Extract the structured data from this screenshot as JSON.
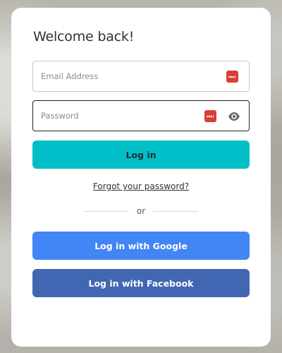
{
  "login": {
    "title": "Welcome back!",
    "email": {
      "placeholder": "Email Address",
      "value": ""
    },
    "password": {
      "placeholder": "Password",
      "value": ""
    },
    "login_button": "Log in",
    "forgot_link": "Forgot your password?",
    "divider_text": "or",
    "google_button": "Log in with Google",
    "facebook_button": "Log in with Facebook"
  },
  "icons": {
    "password_manager": "password-manager-icon",
    "show_password": "eye-icon"
  },
  "colors": {
    "login_button": "#00bfc8",
    "google_button": "#4285f4",
    "facebook_button": "#4267b2",
    "password_manager_icon": "#d93f35"
  }
}
